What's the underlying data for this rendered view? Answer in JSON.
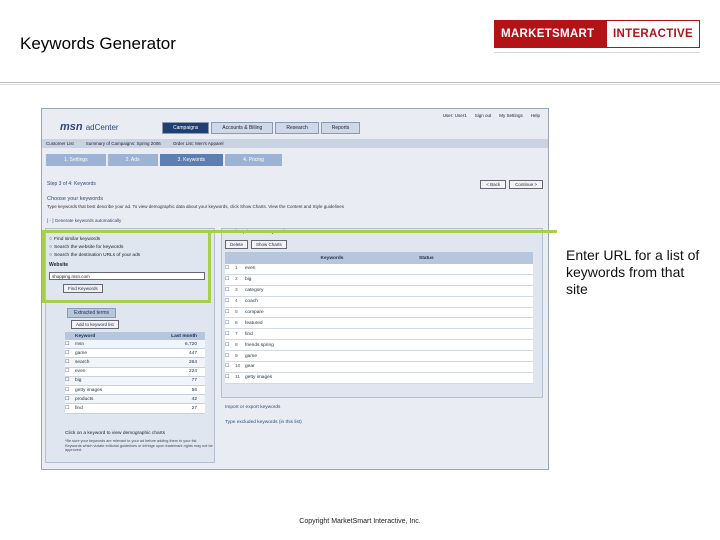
{
  "slide": {
    "title": "Keywords Generator",
    "logo_left": "MARKETSMART",
    "logo_right": "INTERACTIVE",
    "callout": "Enter URL for a list of keywords from that site",
    "copyright": "Copyright MarketSmart Interactive, Inc.",
    "highlight_color": "#a6cf4c"
  },
  "app": {
    "brand": "msn",
    "brand_suffix": "adCenter",
    "top_links": [
      "User: User1",
      "Sign out",
      "My Settings",
      "Help"
    ],
    "nav_tabs": [
      "Campaigns",
      "Accounts & Billing",
      "Research",
      "Reports"
    ],
    "crumbs": [
      "Customer List",
      "Summary of Campaigns: Spring 2006",
      "Order List: Men's Apparel"
    ],
    "steps": [
      "1. Settings",
      "2. Ads",
      "3. Keywords",
      "4. Pricing"
    ],
    "step_heading": "Step 3 of 4:  Keywords",
    "back_button": "< Back",
    "continue_button": "Continue >",
    "choose_heading": "Choose your keywords",
    "choose_sub": "Type keywords that best describe your ad. To view demographic data about your keywords, click Show Charts. View the Content and Style guidelines",
    "generate_link": "[ - ] Generate keywords automatically",
    "options": [
      "Find similar keywords",
      "Search the website for keywords",
      "Search the destination URLs of your ads"
    ],
    "website_label": "Website",
    "website_value": "shopping.msn.com",
    "find_button": "Find Keywords",
    "extracted_title": "Extracted terms",
    "add_to_list": "Add to keyword list",
    "left_table": {
      "headers": [
        "Keyword",
        "Last month"
      ],
      "rows": [
        [
          "msn",
          "6,720"
        ],
        [
          "game",
          "447"
        ],
        [
          "search",
          "264"
        ],
        [
          "even",
          "224"
        ],
        [
          "big",
          "77"
        ],
        [
          "getty images",
          "56"
        ],
        [
          "products",
          "42"
        ],
        [
          "find",
          "27"
        ]
      ]
    },
    "left_hint": "Click on a keyword to view demographic charts",
    "left_fine": "*Be sure your keywords are relevant to your ad before adding them to your list. Keywords which violate editorial guidelines or infringe upon trademark rights may not be approved.",
    "right_tabs": [
      "Match Options",
      "Keywords"
    ],
    "right_buttons": [
      "Delete",
      "Show Charts"
    ],
    "right_table": {
      "headers": [
        "Keywords",
        "Status"
      ],
      "rows": [
        [
          "1",
          "even"
        ],
        [
          "2",
          "big"
        ],
        [
          "3",
          "category"
        ],
        [
          "4",
          "coach"
        ],
        [
          "5",
          "compare"
        ],
        [
          "6",
          "featured"
        ],
        [
          "7",
          "find"
        ],
        [
          "8",
          "friends spring"
        ],
        [
          "9",
          "game"
        ],
        [
          "10",
          "gear"
        ],
        [
          "11",
          "getty images"
        ]
      ]
    },
    "right_link1": "Import or export keywords",
    "right_link2": "Type excluded keywords (in this list)"
  }
}
